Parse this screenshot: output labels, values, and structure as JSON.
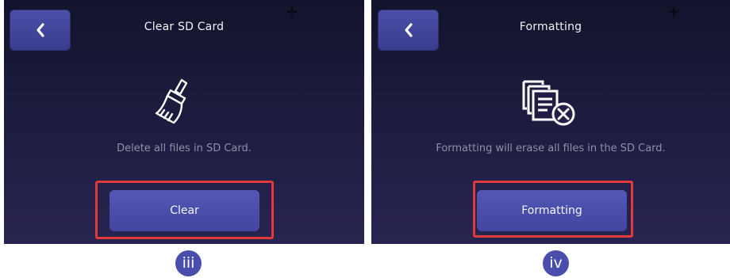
{
  "left_screen": {
    "title": "Clear SD Card",
    "icon": "broom-icon",
    "message": "Delete all files in SD Card.",
    "action_label": "Clear",
    "step_label": "iii"
  },
  "right_screen": {
    "title": "Formatting",
    "icon": "format-files-icon",
    "message": "Formatting will erase all files in the SD Card.",
    "action_label": "Formatting",
    "step_label": "iv"
  },
  "colors": {
    "highlight": "#e23a3a",
    "button": "#4a4fae",
    "badge": "#4a4dac",
    "background_top": "#13132d",
    "background_bottom": "#282451"
  }
}
